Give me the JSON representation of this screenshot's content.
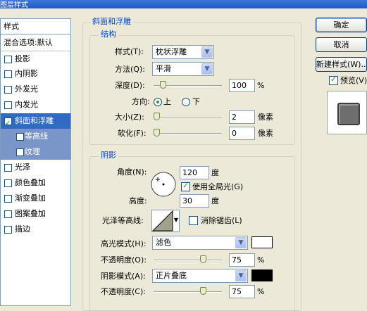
{
  "window": {
    "title": "图层样式"
  },
  "left_list": {
    "header": "样式",
    "blend": "混合选项:默认",
    "items": [
      {
        "label": "投影",
        "checked": false
      },
      {
        "label": "内阴影",
        "checked": false
      },
      {
        "label": "外发光",
        "checked": false
      },
      {
        "label": "内发光",
        "checked": false
      },
      {
        "label": "斜面和浮雕",
        "checked": true
      },
      {
        "label": "等高线",
        "checked": false
      },
      {
        "label": "纹理",
        "checked": false
      },
      {
        "label": "光泽",
        "checked": false
      },
      {
        "label": "颜色叠加",
        "checked": false
      },
      {
        "label": "渐变叠加",
        "checked": false
      },
      {
        "label": "图案叠加",
        "checked": false
      },
      {
        "label": "描边",
        "checked": false
      }
    ]
  },
  "panel": {
    "title": "斜面和浮雕"
  },
  "structure": {
    "title": "结构",
    "style_label": "样式(T):",
    "style_value": "枕状浮雕",
    "technique_label": "方法(Q):",
    "technique_value": "平滑",
    "depth_label": "深度(D):",
    "depth_value": "100",
    "depth_unit": "%",
    "depth_fraction": 0.1,
    "direction_label": "方向:",
    "direction_up": "上",
    "direction_down": "下",
    "size_label": "大小(Z):",
    "size_value": "2",
    "size_unit": "像素",
    "size_fraction": 0.0,
    "soften_label": "软化(F):",
    "soften_value": "0",
    "soften_unit": "像素",
    "soften_fraction": 0.0
  },
  "shading": {
    "title": "阴影",
    "angle_label": "角度(N):",
    "angle_value": "120",
    "angle_unit": "度",
    "global_light_label": "使用全局光(G)",
    "altitude_label": "高度:",
    "altitude_value": "30",
    "altitude_unit": "度",
    "gloss_label": "光泽等高线:",
    "antialias_label": "消除锯齿(L)",
    "highlight_mode_label": "高光模式(H):",
    "highlight_mode_value": "滤色",
    "highlight_color": "#ffffff",
    "highlight_opacity_label": "不透明度(O):",
    "highlight_opacity_value": "75",
    "highlight_opacity_unit": "%",
    "highlight_opacity_fraction": 0.75,
    "shadow_mode_label": "阴影模式(A):",
    "shadow_mode_value": "正片叠底",
    "shadow_color": "#000000",
    "shadow_opacity_label": "不透明度(C):",
    "shadow_opacity_value": "75",
    "shadow_opacity_unit": "%",
    "shadow_opacity_fraction": 0.75
  },
  "buttons": {
    "ok": "确定",
    "cancel": "取消",
    "new_style": "新建样式(W)...",
    "preview": "预览(V)"
  }
}
